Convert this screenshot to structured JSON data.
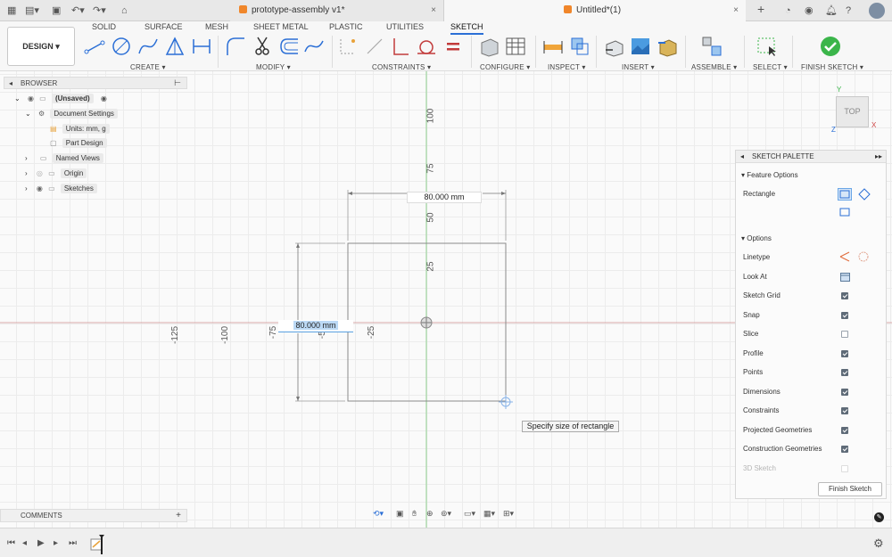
{
  "tabs": {
    "doc1": "prototype-assembly v1*",
    "doc2": "Untitled*(1)",
    "close": "×"
  },
  "toolbar": {
    "design": "DESIGN",
    "tabs": [
      "SOLID",
      "SURFACE",
      "MESH",
      "SHEET METAL",
      "PLASTIC",
      "UTILITIES",
      "SKETCH"
    ],
    "groups": [
      "CREATE",
      "MODIFY",
      "CONSTRAINTS",
      "CONFIGURE",
      "INSPECT",
      "INSERT",
      "ASSEMBLE",
      "SELECT",
      "FINISH SKETCH"
    ]
  },
  "browser": {
    "title": "BROWSER",
    "items": [
      "(Unsaved)",
      "Document Settings",
      "Units: mm, g",
      "Part Design",
      "Named Views",
      "Origin",
      "Sketches"
    ]
  },
  "canvas": {
    "y_ticks": [
      "100",
      "75",
      "50",
      "25"
    ],
    "x_ticks": [
      "-125",
      "-100",
      "-75",
      "-50",
      "-25"
    ],
    "dim_top": "80.000 mm",
    "dim_left": "80.000 mm",
    "tooltip": "Specify size of rectangle",
    "viewcube": "TOP",
    "axis_y": "Y",
    "axis_x": "X",
    "axis_z": "Z"
  },
  "palette": {
    "title": "SKETCH PALETTE",
    "feature_options": "Feature Options",
    "rectangle": "Rectangle",
    "options": "Options",
    "rows": [
      {
        "label": "Linetype",
        "type": "icon"
      },
      {
        "label": "Look At",
        "type": "icon"
      },
      {
        "label": "Sketch Grid",
        "checked": true
      },
      {
        "label": "Snap",
        "checked": true
      },
      {
        "label": "Slice",
        "checked": false
      },
      {
        "label": "Profile",
        "checked": true
      },
      {
        "label": "Points",
        "checked": true
      },
      {
        "label": "Dimensions",
        "checked": true
      },
      {
        "label": "Constraints",
        "checked": true
      },
      {
        "label": "Projected Geometries",
        "checked": true
      },
      {
        "label": "Construction Geometries",
        "checked": true
      },
      {
        "label": "3D Sketch",
        "checked": false,
        "disabled": true
      }
    ],
    "finish": "Finish Sketch"
  },
  "comments": {
    "label": "COMMENTS",
    "add": "+"
  },
  "colors": {
    "accent": "#2b6fd6",
    "finish_green": "#3bb54a",
    "sketch_line": "#8a8a8a",
    "axis_green": "#7ac27a",
    "axis_red": "#d99a9a"
  }
}
